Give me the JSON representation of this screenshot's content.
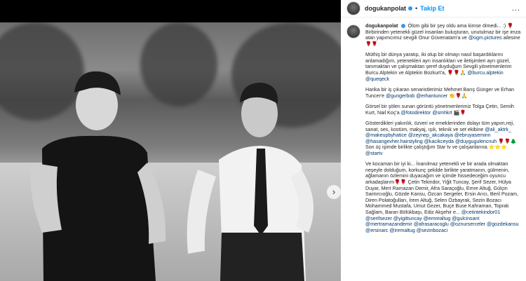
{
  "post": {
    "username": "dogukanpolat",
    "separator": "•",
    "follow_label": "Takip Et",
    "more_label": "...",
    "verified_icon": "verified-badge-icon"
  },
  "caption": {
    "username": "dogukanpolat",
    "p1_text": "Ölüm gibi bir şey oldu ama kimse ölmedi... :) 🌹 Birbirinden yetenekli güzel insanları buluşturan, unutulmaz bir işe imza atan yapımcımız sevgili Onur Güvenatam'a ve",
    "p1_mention": "@ogm.pictures",
    "p1_end": " ailesine🌹🌹",
    "p2_text": "Müthiş bir dünya yaratıp, iki olup bir olmayı nasıl başardıklarını anlamadığım, yetenekleri ayrı insanlıkları ve iletişimleri ayrı güzel, tanımaktan ve çalışmaktan şeref duyduğum Sevgili yönetmenlerim Burcu Alptekin ve Alptekin Bozkurt'a, 🌹🌹🙏",
    "p2_mentions": "@burcu.alptekin @queqeck",
    "p3_text": "Harika bir iş çıkaran senaristlerimiz Mehmet Barış Günger ve Erhan Tuncer'e",
    "p3_mentions": "@gungerbob @erhantuncer",
    "p3_end": " 👏🌹🙏",
    "p4_text": "Görsel bir şölen sunan görüntü yönetmenlerimiz Tolga Çetin, Semih Kurt, Nail Koç'a",
    "p4_mentions": "@fotodirektor @smhkrt",
    "p4_end": " 🎬🌹",
    "p5_text": "Gösterdikleri yakınlık, özveri ve emeklerinden dolayı tüm yapım,reji, sanat, ses, kostüm, makyaj, ışık, teknik ve set ekibine",
    "p5_mentions": "@ali_aktrk_ @makeupbyhatice @zeynep_akcakaya @ebruyaseminn @hasangevher.hairstyling @kacikceyda @duygugulencnuh",
    "p5_end": " 🌹🌹🌲",
    "p5_line2": "Son üç işimde birlikte çalıştığım Star tv ve çalışanlarına.⭐⭐⭐",
    "p5_mention2": "@startv",
    "p6_text": "Ve kocaman bir iyi ki... İnanılmaz yetenekli ve bir arada olmaktan neşeyle dolduğum, korkunç şekilde birlikte yaratmanın, gülmenin, ağlamanın özlemini duyacağım ve içimde hissedeceğim oyuncu arkadaşlarım🌹🌹 Çetin Tekindor, Yiğit Tuncay, Şerif Sezer, Hülya Duyar, Mert Ramazan Demir, Afra Saraçoğlu, Emre Altuğ, Gülçin Santırcıoğlu, Gözde Kansu, Özcan Sergeler, Ersin Arıcı, Beril Pozam, Diren Polatoğulları, İrem Altuğ, Selen Özbayrak, Sezin Bozacı Mohammed Mustafa, Umut Gezer, Buçe Buse Kahraman, Toprak Sağlam, Baran Bölükbaşı, Ediz Akşehir e...",
    "p6_mentions": "@cetintekindor01 @serifsezer @yigittuncay @emrealtug @gulcinsant @mertramazandemir @afrasaracoglu @oznurserceler @gozdekansu @ersinarc @iremaltug @sezinbozaci"
  }
}
